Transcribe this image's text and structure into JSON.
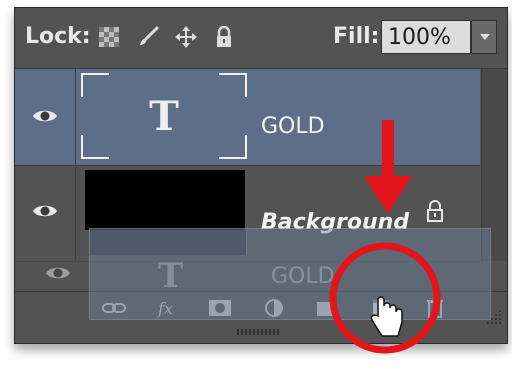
{
  "lock_bar": {
    "lock_label": "Lock:",
    "fill_label": "Fill:",
    "fill_value": "100%"
  },
  "layers": [
    {
      "name": "GOLD",
      "type": "text",
      "selected": true
    },
    {
      "name": "Background",
      "type": "pixel",
      "locked": true
    }
  ],
  "drag_ghost": {
    "name": "GOLD"
  },
  "bottom_bar": {
    "icons": [
      "link-icon",
      "fx-icon",
      "mask-icon",
      "adjustment-icon",
      "group-folder-icon",
      "new-layer-icon",
      "trash-icon"
    ]
  },
  "colors": {
    "panel": "#535353",
    "selected_row": "#5d6f88",
    "annotation_red": "#e3151b"
  }
}
